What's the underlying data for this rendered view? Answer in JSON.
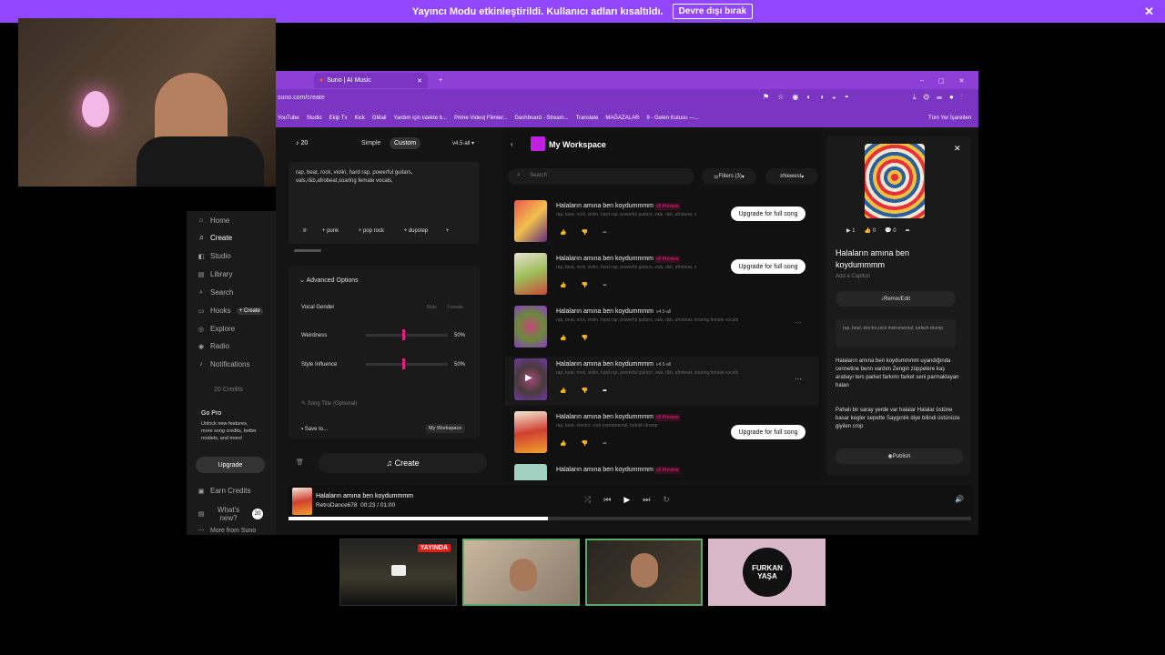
{
  "banner": {
    "text": "Yayıncı Modu etkinleştirildi. Kullanıcı adları kısaltıldı.",
    "button": "Devre dışı bırak",
    "close": "✕"
  },
  "browser": {
    "tab_title": "Suno | AI Music",
    "url": "suno.com/create",
    "bookmarks": [
      "YouTube",
      "Studio",
      "Ekip Tv",
      "Kick",
      "GMail",
      "Yardım için istekte b...",
      "Prime Video| Filmler...",
      "Dashboard - Stream...",
      "Translate",
      "MAĞAZALAR",
      "9 - Gelen Kutusu —..."
    ],
    "all_bookmarks": "Tüm Yer İşaretleri"
  },
  "sidebar": {
    "items": [
      "Home",
      "Create",
      "Studio",
      "Library",
      "Search",
      "Hooks",
      "Explore",
      "Radio",
      "Notifications"
    ],
    "hooks_create": "+ Create",
    "credits": "20 Credits",
    "gopro_title": "Go Pro",
    "gopro_text": "Unlock new features, more song credits, better models, and more!",
    "upgrade": "Upgrade",
    "earn": "Earn Credits",
    "whats_new": "What's new?",
    "whats_new_count": "20",
    "more": "More from Suno"
  },
  "create": {
    "credits": "20",
    "mode_simple": "Simple",
    "mode_custom": "Custom",
    "version": "v4.5-all",
    "style_text": "rap, beat, rock, violin, hard rap, powerful guitars, vals,r&b,afrobeat,soaring female vocals,",
    "chips": [
      "punk",
      "pop rock",
      "dupstep"
    ],
    "advanced": "Advanced Options",
    "vocal_gender": "Vocal Gender",
    "male": "Male",
    "female": "Female",
    "weirdness": "Weirdness",
    "weirdness_val": "50%",
    "style_influence": "Style Influence",
    "style_val": "50%",
    "song_title_ph": "Song Title (Optional)",
    "save_to": "Save to...",
    "workspace_btn": "My Workspace",
    "create_btn": "Create"
  },
  "workspace": {
    "title": "My Workspace",
    "search_ph": "Search",
    "filters": "Filters (3)",
    "sort": "Newest"
  },
  "songs": [
    {
      "title": "Halaların amına ben koydummmm",
      "badge": "v5 Preview",
      "tags": "rap, beat, rock, violin, hard rap, powerful guitars, vals, r&b, afrobeat, s",
      "action": "Upgrade for full song"
    },
    {
      "title": "Halaların amına ben koydummmm",
      "badge": "v5 Preview",
      "tags": "rap, beat, rock, violin, hard rap, powerful guitars, vals, r&b, afrobeat, s",
      "action": "Upgrade for full song"
    },
    {
      "title": "Halaların amına ben koydummmm",
      "badge": "v4.5-all",
      "tags": "rap, beat, rock, violin, hard rap, powerful guitars, vals, r&b, afrobeat, soaring female vocals",
      "action": ""
    },
    {
      "title": "Halaların amına ben koydummmm",
      "badge": "v4.5-all",
      "tags": "rap, beat, rock, violin, hard rap, powerful guitars, vals, r&b, afrobeat, soaring female vocals",
      "action": ""
    },
    {
      "title": "Halaların amına ben koydummmm",
      "badge": "v5 Preview",
      "tags": "rap, beat, electro, rock instrumental, turkish drump",
      "action": "Upgrade for full song"
    },
    {
      "title": "Halaların amına ben koydummmm",
      "badge": "v5 Preview",
      "tags": "",
      "action": ""
    }
  ],
  "detail": {
    "plays": "1",
    "likes": "0",
    "comments": "0",
    "title": "Halaların amına ben koydummmm",
    "caption": "Add a Caption",
    "remix": "Remix/Edit",
    "tags": "rap, beat, electro,rock instrumental, turkish drump",
    "lyrics1": "Halaların amına ben koydummmm uyandığında cennetine benn vardım Zengin züppelere kaş arabayı ters parket farkımı farket seni parmaklayan halan",
    "lyrics2": "Pahalı bir saray yerde var halalar Halalar üstüne basar kegler sepette Saygınlık diye bilindi üstünüze giyilen crop",
    "publish": "Publish"
  },
  "player": {
    "title": "Halaların amına ben koydummmm",
    "artist": "RetroDance678",
    "time": "00:23 / 01:00",
    "progress": 0.38
  },
  "strip": {
    "live_badge": "YAYINDA",
    "name_logo": "FURKAN YAŞA"
  },
  "colors": {
    "banner": "#9146ff",
    "tabbar": "#8e3fd6",
    "accent": "#e91e8c",
    "bg": "#141414"
  }
}
